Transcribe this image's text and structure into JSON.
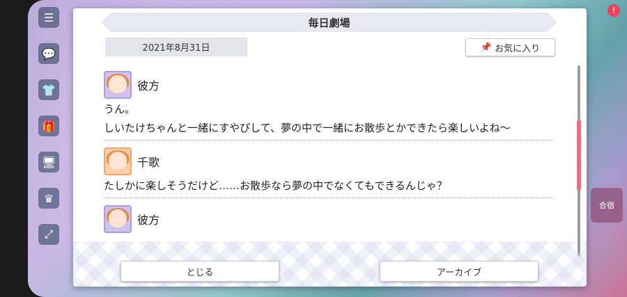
{
  "dialog": {
    "title": "毎日劇場",
    "date": "2021年8月31日",
    "favorite_label": "お気に入り",
    "entries": [
      {
        "speaker": "彼方",
        "avatar": "kanata",
        "lines": [
          "うん。",
          "しいたけちゃんと一緒にすやぴして、夢の中で一緒にお散歩とかできたら楽しいよね〜"
        ]
      },
      {
        "speaker": "千歌",
        "avatar": "chika",
        "lines": [
          "たしかに楽しそうだけど……お散歩なら夢の中でなくてもできるんじゃ？"
        ]
      },
      {
        "speaker": "彼方",
        "avatar": "kanata",
        "lines": []
      }
    ],
    "close_label": "とじる",
    "archive_label": "アーカイブ"
  },
  "background": {
    "right_label": "合宿"
  },
  "icons": {
    "favorite": "pin-icon",
    "menu": "menu-icon"
  },
  "colors": {
    "scroll_thumb": "#ef6b82",
    "title_bar": "#e9eaf1",
    "date_box": "#e3e4ec"
  }
}
